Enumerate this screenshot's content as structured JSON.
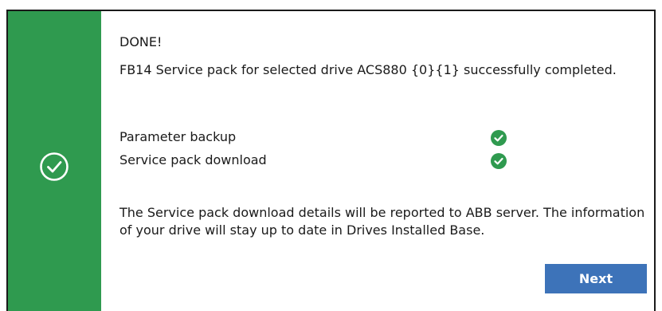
{
  "dialog": {
    "title": "DONE!",
    "message": "FB14 Service pack for selected drive ACS880 {0}{1} successfully completed.",
    "accent_color": "#2f9a4f",
    "side_icon": "check-circle-icon",
    "steps": [
      {
        "label": "Parameter backup",
        "status": "success",
        "icon": "check-icon"
      },
      {
        "label": "Service pack download",
        "status": "success",
        "icon": "check-icon"
      }
    ],
    "report_text": "The Service pack download details will be reported to ABB server. The information of your drive will stay up to date in Drives Installed Base.",
    "next_button": {
      "label": "Next",
      "color": "#3d73b9"
    }
  }
}
